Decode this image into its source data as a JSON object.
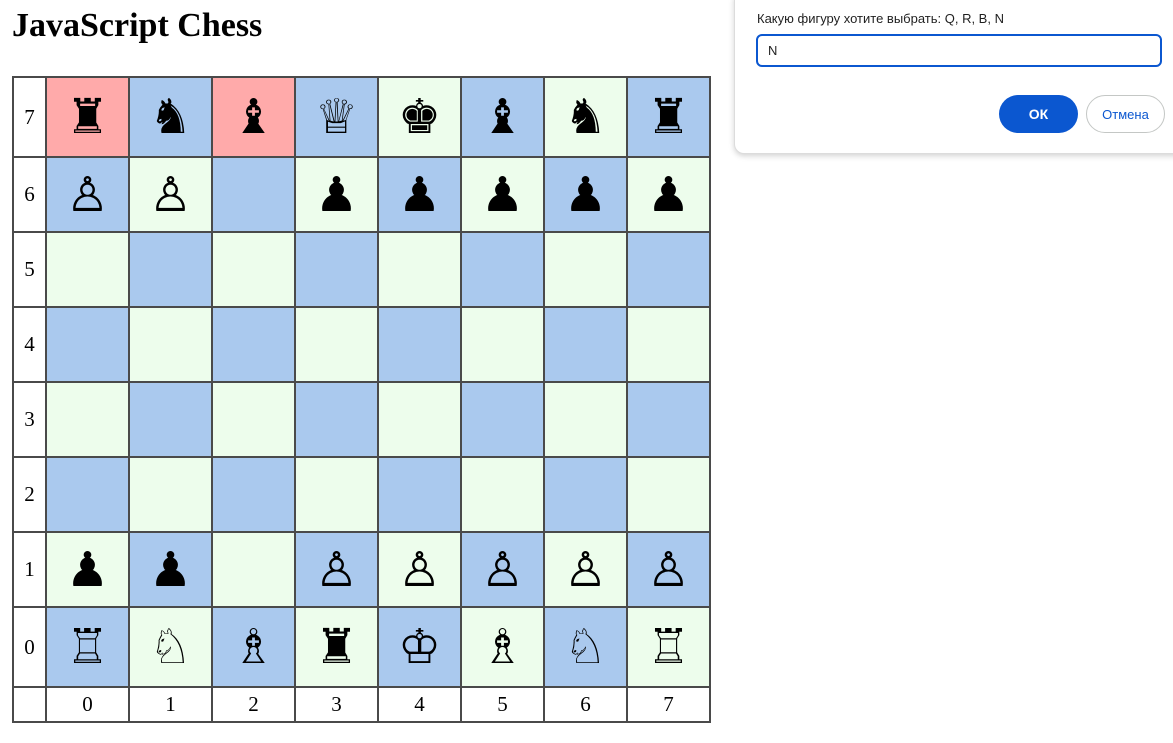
{
  "page": {
    "title": "JavaScript Chess"
  },
  "colors": {
    "blue_square": "#aac9ee",
    "green_square": "#edfdec",
    "highlight_square": "#ffaaaa",
    "accent": "#0b57d0"
  },
  "board": {
    "rank_labels": [
      "7",
      "6",
      "5",
      "4",
      "3",
      "2",
      "1",
      "0"
    ],
    "file_labels": [
      "0",
      "1",
      "2",
      "3",
      "4",
      "5",
      "6",
      "7"
    ],
    "rows": [
      {
        "squares": [
          {
            "piece": "black-rook",
            "glyph": "♜",
            "color": "#ffaaaa"
          },
          {
            "piece": "black-knight",
            "glyph": "♞",
            "color": "#aac9ee"
          },
          {
            "piece": "black-bishop",
            "glyph": "♝",
            "color": "#ffaaaa"
          },
          {
            "piece": "white-queen",
            "glyph": "♕",
            "color": "#aac9ee"
          },
          {
            "piece": "black-king",
            "glyph": "♚",
            "color": "#edfdec"
          },
          {
            "piece": "black-bishop",
            "glyph": "♝",
            "color": "#aac9ee"
          },
          {
            "piece": "black-knight",
            "glyph": "♞",
            "color": "#edfdec"
          },
          {
            "piece": "black-rook",
            "glyph": "♜",
            "color": "#aac9ee"
          }
        ]
      },
      {
        "squares": [
          {
            "piece": "white-pawn",
            "glyph": "♙",
            "color": "#aac9ee"
          },
          {
            "piece": "white-pawn",
            "glyph": "♙",
            "color": "#edfdec"
          },
          {
            "piece": "",
            "glyph": "",
            "color": "#aac9ee"
          },
          {
            "piece": "black-pawn",
            "glyph": "♟",
            "color": "#edfdec"
          },
          {
            "piece": "black-pawn",
            "glyph": "♟",
            "color": "#aac9ee"
          },
          {
            "piece": "black-pawn",
            "glyph": "♟",
            "color": "#edfdec"
          },
          {
            "piece": "black-pawn",
            "glyph": "♟",
            "color": "#aac9ee"
          },
          {
            "piece": "black-pawn",
            "glyph": "♟",
            "color": "#edfdec"
          }
        ]
      },
      {
        "squares": [
          {
            "piece": "",
            "glyph": "",
            "color": "#edfdec"
          },
          {
            "piece": "",
            "glyph": "",
            "color": "#aac9ee"
          },
          {
            "piece": "",
            "glyph": "",
            "color": "#edfdec"
          },
          {
            "piece": "",
            "glyph": "",
            "color": "#aac9ee"
          },
          {
            "piece": "",
            "glyph": "",
            "color": "#edfdec"
          },
          {
            "piece": "",
            "glyph": "",
            "color": "#aac9ee"
          },
          {
            "piece": "",
            "glyph": "",
            "color": "#edfdec"
          },
          {
            "piece": "",
            "glyph": "",
            "color": "#aac9ee"
          }
        ]
      },
      {
        "squares": [
          {
            "piece": "",
            "glyph": "",
            "color": "#aac9ee"
          },
          {
            "piece": "",
            "glyph": "",
            "color": "#edfdec"
          },
          {
            "piece": "",
            "glyph": "",
            "color": "#aac9ee"
          },
          {
            "piece": "",
            "glyph": "",
            "color": "#edfdec"
          },
          {
            "piece": "",
            "glyph": "",
            "color": "#aac9ee"
          },
          {
            "piece": "",
            "glyph": "",
            "color": "#edfdec"
          },
          {
            "piece": "",
            "glyph": "",
            "color": "#aac9ee"
          },
          {
            "piece": "",
            "glyph": "",
            "color": "#edfdec"
          }
        ]
      },
      {
        "squares": [
          {
            "piece": "",
            "glyph": "",
            "color": "#edfdec"
          },
          {
            "piece": "",
            "glyph": "",
            "color": "#aac9ee"
          },
          {
            "piece": "",
            "glyph": "",
            "color": "#edfdec"
          },
          {
            "piece": "",
            "glyph": "",
            "color": "#aac9ee"
          },
          {
            "piece": "",
            "glyph": "",
            "color": "#edfdec"
          },
          {
            "piece": "",
            "glyph": "",
            "color": "#aac9ee"
          },
          {
            "piece": "",
            "glyph": "",
            "color": "#edfdec"
          },
          {
            "piece": "",
            "glyph": "",
            "color": "#aac9ee"
          }
        ]
      },
      {
        "squares": [
          {
            "piece": "",
            "glyph": "",
            "color": "#aac9ee"
          },
          {
            "piece": "",
            "glyph": "",
            "color": "#edfdec"
          },
          {
            "piece": "",
            "glyph": "",
            "color": "#aac9ee"
          },
          {
            "piece": "",
            "glyph": "",
            "color": "#edfdec"
          },
          {
            "piece": "",
            "glyph": "",
            "color": "#aac9ee"
          },
          {
            "piece": "",
            "glyph": "",
            "color": "#edfdec"
          },
          {
            "piece": "",
            "glyph": "",
            "color": "#aac9ee"
          },
          {
            "piece": "",
            "glyph": "",
            "color": "#edfdec"
          }
        ]
      },
      {
        "squares": [
          {
            "piece": "black-pawn",
            "glyph": "♟",
            "color": "#edfdec"
          },
          {
            "piece": "black-pawn",
            "glyph": "♟",
            "color": "#aac9ee"
          },
          {
            "piece": "",
            "glyph": "",
            "color": "#edfdec"
          },
          {
            "piece": "white-pawn",
            "glyph": "♙",
            "color": "#aac9ee"
          },
          {
            "piece": "white-pawn",
            "glyph": "♙",
            "color": "#edfdec"
          },
          {
            "piece": "white-pawn",
            "glyph": "♙",
            "color": "#aac9ee"
          },
          {
            "piece": "white-pawn",
            "glyph": "♙",
            "color": "#edfdec"
          },
          {
            "piece": "white-pawn",
            "glyph": "♙",
            "color": "#aac9ee"
          }
        ]
      },
      {
        "squares": [
          {
            "piece": "white-rook",
            "glyph": "♖",
            "color": "#aac9ee"
          },
          {
            "piece": "white-knight",
            "glyph": "♘",
            "color": "#edfdec"
          },
          {
            "piece": "white-bishop",
            "glyph": "♗",
            "color": "#aac9ee"
          },
          {
            "piece": "black-rook",
            "glyph": "♜",
            "color": "#edfdec"
          },
          {
            "piece": "white-king",
            "glyph": "♔",
            "color": "#aac9ee"
          },
          {
            "piece": "white-bishop",
            "glyph": "♗",
            "color": "#edfdec"
          },
          {
            "piece": "white-knight",
            "glyph": "♘",
            "color": "#aac9ee"
          },
          {
            "piece": "white-rook",
            "glyph": "♖",
            "color": "#edfdec"
          }
        ]
      }
    ]
  },
  "dialog": {
    "prompt": "Какую фигуру хотите выбрать: Q, R, B, N",
    "input_value": "N",
    "ok_label": "ОК",
    "cancel_label": "Отмена"
  }
}
